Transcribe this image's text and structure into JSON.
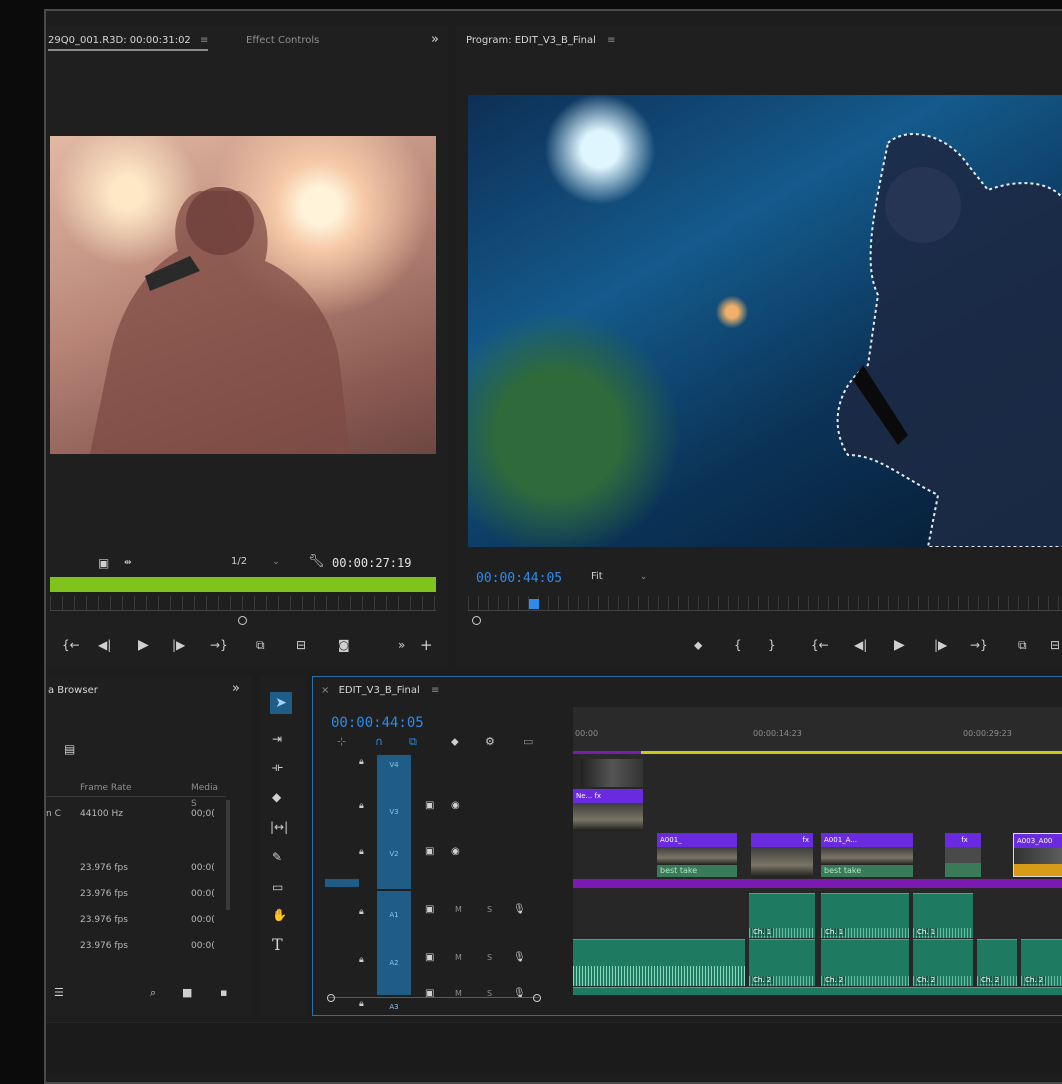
{
  "source_panel": {
    "tab_title": "29Q0_001.R3D: 00:00:31:02",
    "menu_glyph": "≡",
    "effect_controls_tab": "Effect Controls",
    "expand_glyph": "»",
    "resolution": "1/2",
    "timecode": "00:00:27:19",
    "marker_icon": "marker-icon",
    "controls": [
      "{←",
      "◀|",
      "▶",
      "|▶",
      "→}",
      "insert",
      "overwrite",
      "camera"
    ]
  },
  "program_panel": {
    "tab_title": "Program: EDIT_V3_B_Final",
    "menu_glyph": "≡",
    "timecode": "00:00:44:05",
    "zoom": "Fit",
    "controls": [
      "⬥",
      "{",
      "}",
      "{←",
      "◀|",
      "▶",
      "|▶",
      "→}",
      "lift"
    ]
  },
  "media_browser": {
    "tab_title": "a Browser",
    "expand_glyph": "»",
    "columns": [
      "Frame Rate",
      "Media S"
    ],
    "rows": [
      {
        "name": "n C",
        "rate": "44100 Hz",
        "media": "00;0("
      },
      {
        "name": "",
        "rate": "23.976 fps",
        "media": "00:0("
      },
      {
        "name": "",
        "rate": "23.976 fps",
        "media": "00:0("
      },
      {
        "name": "",
        "rate": "23.976 fps",
        "media": "00:0("
      },
      {
        "name": "",
        "rate": "23.976 fps",
        "media": "00:0("
      }
    ],
    "footer_icons": [
      "list-icon",
      "search-icon",
      "folder-icon",
      "trash-icon"
    ]
  },
  "tools": [
    "selection-tool",
    "track-select-tool",
    "ripple-edit-tool",
    "razor-tool",
    "slip-tool",
    "pen-tool",
    "rectangle-tool",
    "hand-tool",
    "type-tool"
  ],
  "timeline": {
    "tab_title": "EDIT_V3_B_Final",
    "close_glyph": "×",
    "menu_glyph": "≡",
    "timecode": "00:00:44:05",
    "ruler": [
      "00:00",
      "00:00:14:23",
      "00:00:29:23"
    ],
    "video_tracks": [
      "V4",
      "V3",
      "V2"
    ],
    "audio_tracks": [
      "A1",
      "A2",
      "A3"
    ],
    "audio_buttons": [
      "M",
      "S"
    ],
    "clips": {
      "v3_clip": "Ne... fx",
      "v2_a001": "A001_",
      "v2_a001_a": "A001_A...",
      "v2_a003": "A003_A00",
      "fx": "fx",
      "best_take": "best take"
    },
    "audio_labels": [
      "Ch. 1",
      "Ch. 1",
      "Ch. 1",
      "Ch. 2",
      "Ch. 2",
      "Ch. 2",
      "Ch. 2",
      "Ch. 2"
    ]
  },
  "colors": {
    "accent_blue": "#2d8ceb",
    "clip_purple": "#6a2ae0",
    "audio_green": "#1f7a62",
    "source_bar_green": "#7fc31c",
    "work_area_yellow": "#c8c81e"
  }
}
